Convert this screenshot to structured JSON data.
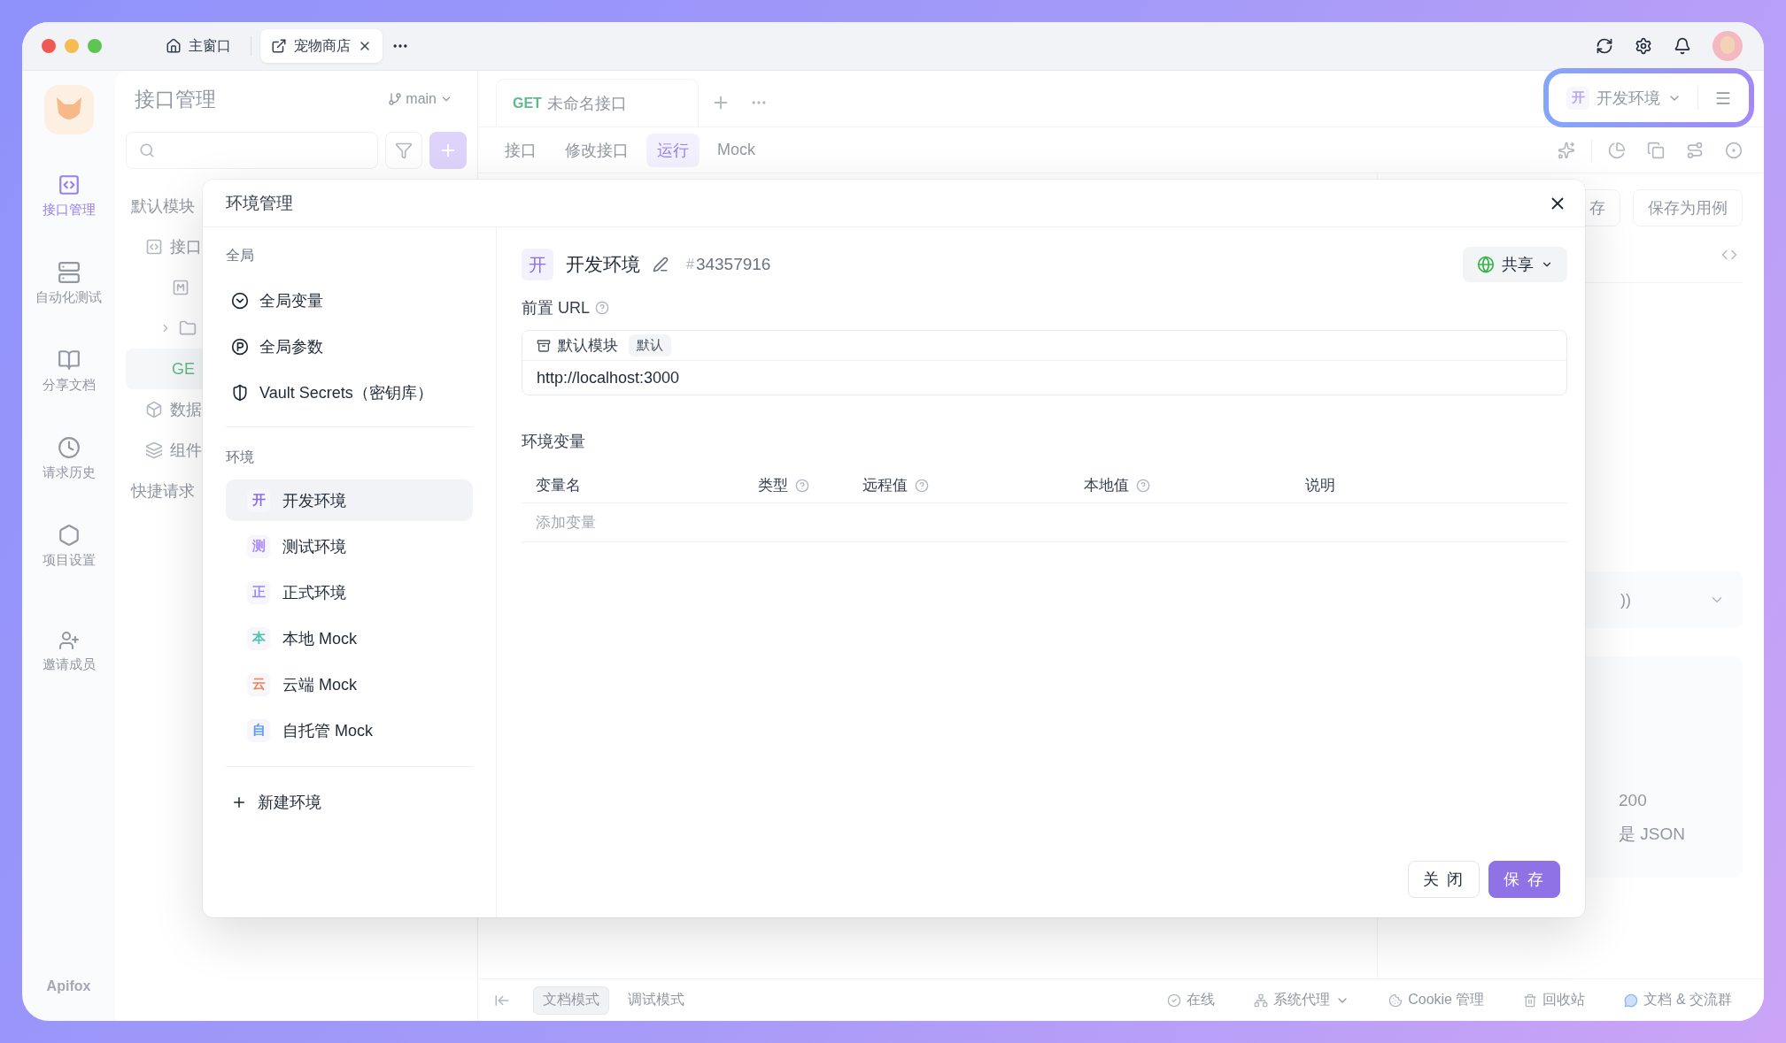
{
  "window_tabs": [
    {
      "kind": "home",
      "label": "主窗口",
      "selected": false
    },
    {
      "kind": "project",
      "label": "宠物商店",
      "selected": true
    }
  ],
  "nav": [
    {
      "label": "接口管理",
      "selected": true
    },
    {
      "label": "自动化测试",
      "selected": false
    },
    {
      "label": "分享文档",
      "selected": false
    },
    {
      "label": "请求历史",
      "selected": false
    },
    {
      "label": "项目设置",
      "selected": false
    }
  ],
  "invite": "邀请成员",
  "brand": "Apifox",
  "sidebar": {
    "title": "接口管理",
    "branch": "main",
    "tree": [
      {
        "kind": "module",
        "label": "默认模块"
      },
      {
        "kind": "api",
        "label": "接口"
      },
      {
        "kind": "mock"
      },
      {
        "kind": "folder"
      },
      {
        "kind": "request",
        "label": "GE"
      },
      {
        "kind": "schema",
        "label": "数据"
      },
      {
        "kind": "component",
        "label": "组件"
      },
      {
        "kind": "quick",
        "label": "快捷请求"
      }
    ]
  },
  "request_tab": {
    "method": "GET",
    "name": "未命名接口"
  },
  "sub_tabs": [
    {
      "label": "接口",
      "selected": false
    },
    {
      "label": "修改接口",
      "selected": false
    },
    {
      "label": "运行",
      "selected": true
    },
    {
      "label": "Mock",
      "selected": false
    }
  ],
  "env_selector": {
    "badge": "开",
    "name": "开发环境"
  },
  "response": {
    "buttons": [
      "存",
      "保存为用例"
    ],
    "select": "))",
    "lines": [
      "200",
      "是 JSON"
    ]
  },
  "status_bar": {
    "modes": [
      {
        "label": "文档模式",
        "selected": true
      },
      {
        "label": "调试模式",
        "selected": false
      }
    ],
    "items": [
      {
        "kind": "online",
        "label": "在线"
      },
      {
        "kind": "proxy",
        "label": "系统代理"
      },
      {
        "kind": "cookie",
        "label": "Cookie 管理"
      },
      {
        "kind": "trash",
        "label": "回收站"
      },
      {
        "kind": "community",
        "label": "文档 & 交流群"
      }
    ]
  },
  "dialog": {
    "title": "环境管理",
    "global_heading": "全局",
    "global_items": [
      {
        "kind": "variables",
        "label": "全局变量"
      },
      {
        "kind": "params",
        "label": "全局参数"
      },
      {
        "kind": "vault",
        "label": "Vault Secrets（密钥库）"
      }
    ],
    "env_heading": "环境",
    "environments": [
      {
        "badge": "开",
        "label": "开发环境",
        "color": "#8b6cf0",
        "selected": true
      },
      {
        "badge": "测",
        "label": "测试环境",
        "color": "#a78bfa",
        "selected": false
      },
      {
        "badge": "正",
        "label": "正式环境",
        "color": "#9b87f5",
        "selected": false
      },
      {
        "badge": "本",
        "label": "本地 Mock",
        "color": "#4fc4b4",
        "selected": false
      },
      {
        "badge": "云",
        "label": "云端 Mock",
        "color": "#f0825a",
        "selected": false
      },
      {
        "badge": "自",
        "label": "自托管 Mock",
        "color": "#5b9cf6",
        "selected": false
      }
    ],
    "new_env": "新建环境",
    "detail": {
      "badge": "开",
      "name": "开发环境",
      "id_mark": "#",
      "id": "34357916",
      "share": "共享",
      "prefix_label": "前置 URL",
      "module": "默认模块",
      "module_tag": "默认",
      "url": "http://localhost:3000",
      "vars_heading": "环境变量",
      "columns": [
        {
          "label": "变量名",
          "help": false
        },
        {
          "label": "类型",
          "help": true
        },
        {
          "label": "远程值",
          "help": true
        },
        {
          "label": "本地值",
          "help": true
        },
        {
          "label": "说明",
          "help": false
        }
      ],
      "add_placeholder": "添加变量"
    },
    "buttons": [
      {
        "kind": "secondary",
        "label": "关 闭"
      },
      {
        "kind": "primary",
        "label": "保 存"
      }
    ]
  }
}
